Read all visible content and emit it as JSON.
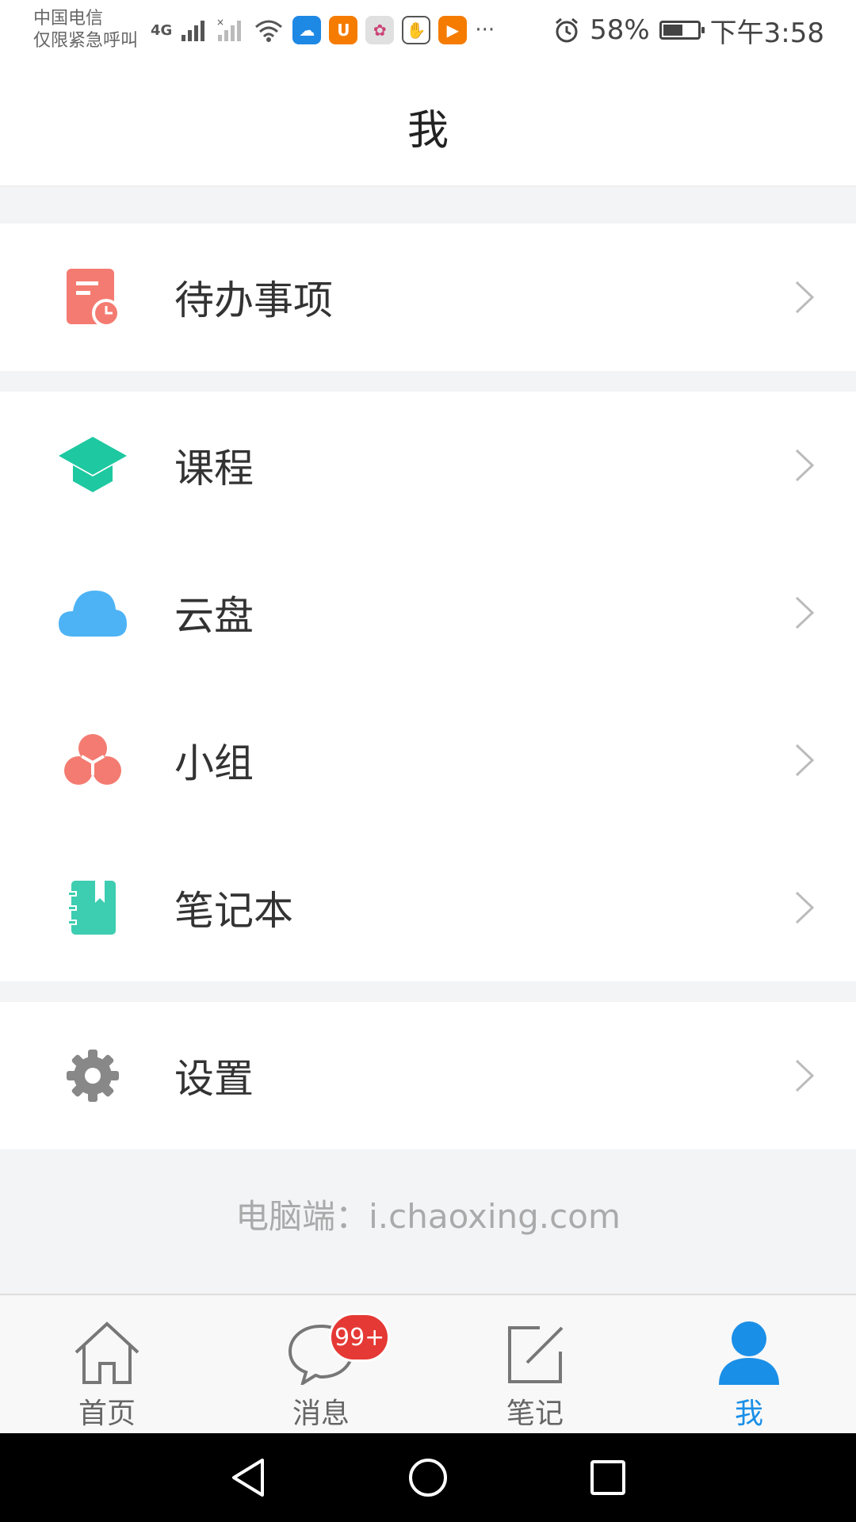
{
  "status_bar": {
    "carrier_line1": "中国电信",
    "carrier_line2": "仅限紧急呼叫",
    "network": "4G",
    "more": "···",
    "battery": "58%",
    "battery_level": 0.58,
    "time": "下午3:58"
  },
  "header": {
    "title": "我"
  },
  "menu": {
    "todo": "待办事项",
    "course": "课程",
    "cloud": "云盘",
    "group": "小组",
    "notebook": "笔记本",
    "settings": "设置"
  },
  "footer_note": "电脑端：i.chaoxing.com",
  "tabs": {
    "home": "首页",
    "messages": "消息",
    "messages_badge": "99+",
    "notes": "笔记",
    "me": "我"
  },
  "colors": {
    "active_tab": "#1a8fe8",
    "todo_icon": "#f47b71",
    "course_icon": "#1ec8a0",
    "cloud_icon": "#4db3f5",
    "group_icon": "#f47b71",
    "notebook_icon": "#3dcdb0",
    "settings_icon": "#888888",
    "badge": "#e53935"
  }
}
